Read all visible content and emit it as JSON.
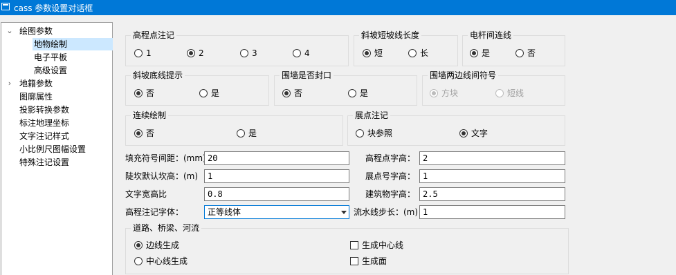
{
  "window": {
    "title": "cass 参数设置对话框"
  },
  "tree": {
    "items": [
      {
        "label": "绘图参数"
      },
      {
        "label": "地物绘制"
      },
      {
        "label": "电子平板"
      },
      {
        "label": "高级设置"
      },
      {
        "label": "地籍参数"
      },
      {
        "label": "图廓属性"
      },
      {
        "label": "投影转换参数"
      },
      {
        "label": "标注地理坐标"
      },
      {
        "label": "文字注记样式"
      },
      {
        "label": "小比例尺图幅设置"
      },
      {
        "label": "特殊注记设置"
      }
    ],
    "selected": "地物绘制"
  },
  "groups": {
    "elevation_note": {
      "title": "高程点注记",
      "options": [
        "1",
        "2",
        "3",
        "4"
      ],
      "selected": "2"
    },
    "slope_short_len": {
      "title": "斜坡短坡线长度",
      "options": [
        "短",
        "长"
      ],
      "selected": "短"
    },
    "pole_connect": {
      "title": "电杆间连线",
      "options": [
        "是",
        "否"
      ],
      "selected": "是"
    },
    "slope_bottom_hint": {
      "title": "斜坡底线提示",
      "options": [
        "否",
        "是"
      ],
      "selected": "否"
    },
    "wall_closed": {
      "title": "围墙是否封口",
      "options": [
        "否",
        "是"
      ],
      "selected": "否"
    },
    "wall_symbol": {
      "title": "围墙两边线间符号",
      "options": [
        "方块",
        "短线"
      ],
      "selected": "方块",
      "disabled": true
    },
    "continuous_draw": {
      "title": "连续绘制",
      "options": [
        "否",
        "是"
      ],
      "selected": "否"
    },
    "point_note": {
      "title": "展点注记",
      "options": [
        "块参照",
        "文字"
      ],
      "selected": "文字"
    },
    "road_bridge": {
      "title": "道路、桥梁、河流",
      "radios": [
        "边线生成",
        "中心线生成"
      ],
      "selected": "边线生成",
      "checkboxes": [
        {
          "label": "生成中心线",
          "checked": false
        },
        {
          "label": "生成面",
          "checked": false
        }
      ]
    }
  },
  "fields": {
    "fill_spacing": {
      "label": "填充符号间距：(mm)",
      "value": "20"
    },
    "elev_text_height": {
      "label": "高程点字高：",
      "value": "2"
    },
    "steep_height": {
      "label": "陡坎默认坎高：(m)",
      "value": "1"
    },
    "point_no_height": {
      "label": "展点号字高：",
      "value": "1"
    },
    "text_aspect": {
      "label": "文字宽高比",
      "value": "0.8"
    },
    "building_text_height": {
      "label": "建筑物字高：",
      "value": "2.5"
    },
    "elev_font": {
      "label": "高程注记字体：",
      "value": "正等线体"
    },
    "flow_step": {
      "label": "流水线步长：(m)",
      "value": "1"
    }
  }
}
